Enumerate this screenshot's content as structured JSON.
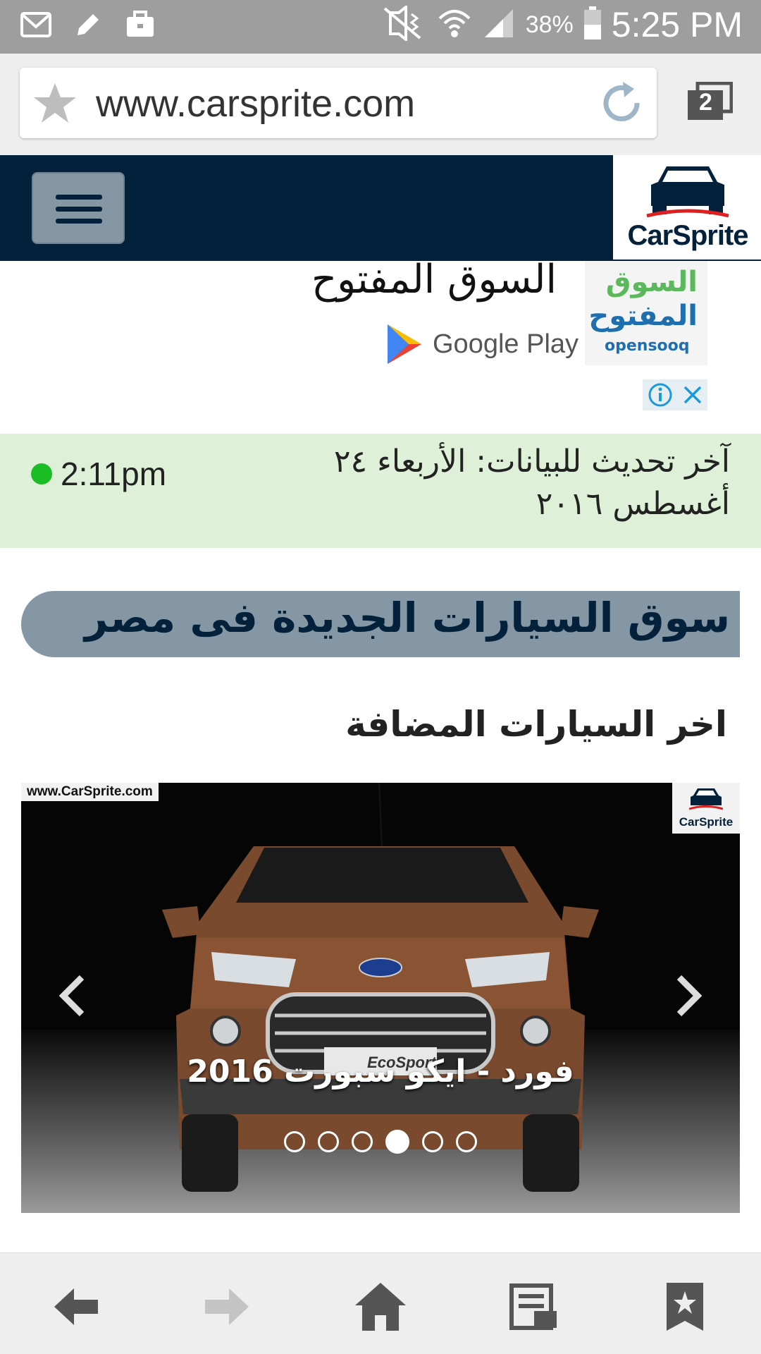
{
  "status_bar": {
    "battery_percent": "38%",
    "time": "5:25 PM"
  },
  "browser": {
    "url": "www.carsprite.com",
    "tab_count": "2"
  },
  "site": {
    "logo_text": "CarSprite"
  },
  "ad": {
    "title": "السوق المفتوح",
    "icon_text_line1": "السوق",
    "icon_text_line2": "المفتوح",
    "icon_text_en": "opensooq",
    "store_label": "Google Play"
  },
  "update_bar": {
    "text": "آخر تحديث للبيانات: الأربعاء ٢٤ أغسطس ٢٠١٦",
    "time": "2:11pm",
    "indicator_color": "#1bbd24"
  },
  "main": {
    "banner": "سوق السيارات الجديدة فى مصر",
    "section_title": "اخر السيارات المضافة"
  },
  "carousel": {
    "watermark": "www.CarSprite.com",
    "watermark_logo": "CarSprite",
    "plate_text": "EcoSport",
    "caption": "فورد - ايكو سبورت 2016",
    "slide_count": 6,
    "active_slide": 4
  },
  "colors": {
    "header_bg": "#03213a",
    "accent_gray": "#8597a4",
    "update_bg": "#dff0d8"
  }
}
